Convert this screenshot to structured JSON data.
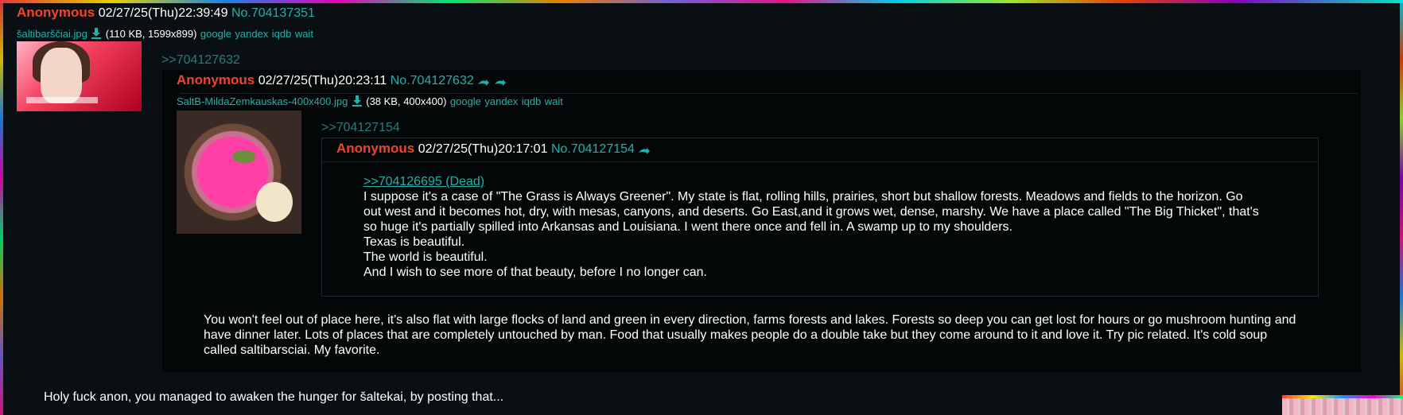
{
  "op": {
    "name": "Anonymous",
    "date": "02/27/25(Thu)22:39:49",
    "postno": "No.704137351",
    "file_name": "šaltibarščiai.jpg",
    "file_meta": "(110 KB, 1599x899)",
    "search_links": [
      "google",
      "yandex",
      "iqdb",
      "wait"
    ],
    "quote": ">>704127632",
    "body": "Holy fuck anon, you managed to awaken the hunger for šaltekai, by posting that..."
  },
  "reply1": {
    "name": "Anonymous",
    "date": "02/27/25(Thu)20:23:11",
    "postno": "No.704127632",
    "file_name": "SaltB-MildaZemkauskas-400x400.jpg",
    "file_meta": "(38 KB, 400x400)",
    "search_links": [
      "google",
      "yandex",
      "iqdb",
      "wait"
    ],
    "quote": ">>704127154",
    "body_lines": [
      "You won't feel out of place here, it's also flat with large flocks of land and green in every direction, farms forests and lakes. Forests so deep you can get lost for hours or go mushroom hunting and",
      "have dinner later. Lots of places that are completely untouched by man. Food that usually makes people do a double take but they come around to it and love it. Try pic related. It's cold soup",
      "called saltibarsciai. My favorite."
    ]
  },
  "reply2": {
    "name": "Anonymous",
    "date": "02/27/25(Thu)20:17:01",
    "postno": "No.704127154",
    "dead_quote": ">>704126695 (Dead)",
    "body_lines": [
      "I suppose it's a case of \"The Grass is Always Greener\". My state is flat, rolling hills, prairies, short but shallow forests. Meadows and fields to the horizon. Go",
      "out west and it becomes hot, dry, with mesas, canyons, and deserts. Go East,and it grows wet, dense, marshy. We have a place called \"The Big Thicket\", that's",
      "so huge it's partially spilled into Arkansas and Louisiana. I went there once and fell in. A swamp up to my shoulders.",
      "Texas is beautiful.",
      "The world is beautiful.",
      "And I wish to see more of that beauty, before I no longer can."
    ]
  },
  "colors": {
    "name": "#f0452a",
    "link": "#20b2aa",
    "quote": "#2a7c78",
    "background": "#0a0f13",
    "reply_bg": "#040708"
  },
  "icons": [
    "download-icon",
    "reply-arrow-icon"
  ]
}
